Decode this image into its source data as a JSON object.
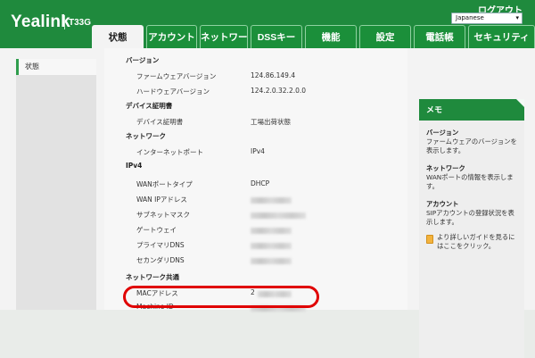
{
  "header": {
    "brand": "Yealink",
    "model": "T33G",
    "logout": "ログアウト",
    "language": {
      "selected": "Japanese",
      "caret": "▾"
    },
    "tabs": [
      {
        "label": "状態",
        "active": true
      },
      {
        "label": "アカウント",
        "active": false
      },
      {
        "label": "ネットワーク",
        "active": false
      },
      {
        "label": "DSSキー",
        "active": false
      },
      {
        "label": "機能",
        "active": false
      },
      {
        "label": "設定",
        "active": false
      },
      {
        "label": "電話帳",
        "active": false
      },
      {
        "label": "セキュリティ",
        "active": false
      }
    ]
  },
  "sidebar": {
    "items": [
      {
        "label": "状態",
        "active": true
      }
    ]
  },
  "main": {
    "sections": [
      {
        "title": "バージョン",
        "rows": [
          {
            "label": "ファームウェアバージョン",
            "value": "124.86.149.4"
          },
          {
            "label": "ハードウェアバージョン",
            "value": "124.2.0.32.2.0.0"
          }
        ]
      },
      {
        "title": "デバイス証明書",
        "rows": [
          {
            "label": "デバイス証明書",
            "value": "工場出荷状態"
          }
        ]
      },
      {
        "title": "ネットワーク",
        "rows": [
          {
            "label": "インターネットポート",
            "value": "IPv4"
          }
        ]
      },
      {
        "title": "IPv4",
        "rows": [
          {
            "label": "WANポートタイプ",
            "value": "DHCP"
          },
          {
            "label": "WAN IPアドレス",
            "value": ""
          },
          {
            "label": "サブネットマスク",
            "value": ""
          },
          {
            "label": "ゲートウェイ",
            "value": ""
          },
          {
            "label": "プライマリDNS",
            "value": ""
          },
          {
            "label": "セカンダリDNS",
            "value": ""
          }
        ]
      },
      {
        "title": "ネットワーク共通",
        "rows": [
          {
            "label": "MACアドレス",
            "value": "2"
          },
          {
            "label": "Machine ID",
            "value": ""
          }
        ]
      }
    ]
  },
  "memo": {
    "title": "メモ",
    "sections": [
      {
        "title": "バージョン",
        "text": "ファームウェアのバージョンを表示します。"
      },
      {
        "title": "ネットワーク",
        "text": "WANポートの情報を表示します。"
      },
      {
        "title": "アカウント",
        "text": "SIPアカウントの登録状況を表示します。"
      }
    ],
    "guide": "より詳しいガイドを見るにはここをクリック。"
  },
  "colors": {
    "brand_green": "#1f8a3d",
    "highlight_red": "#e00000"
  }
}
